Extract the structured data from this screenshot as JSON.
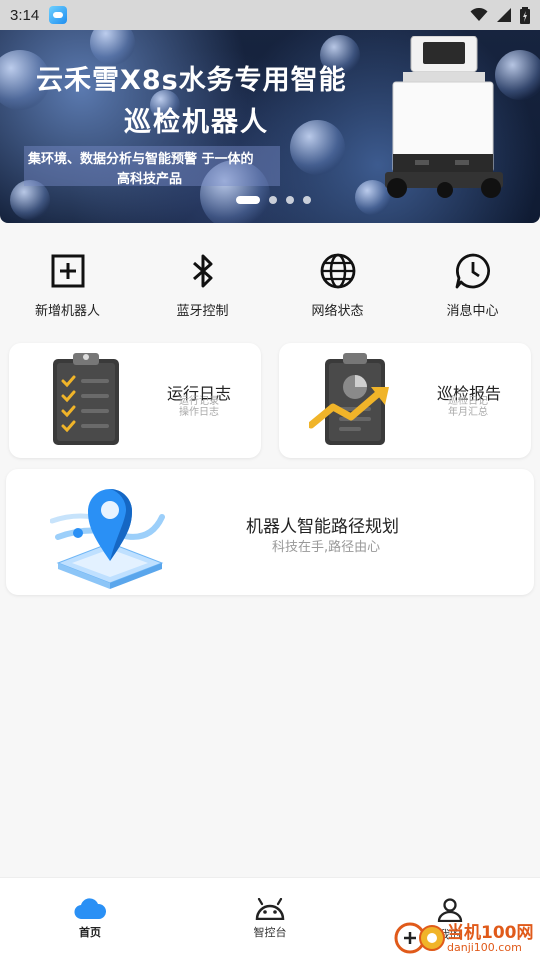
{
  "status_bar": {
    "time": "3:14"
  },
  "banner": {
    "title_line1": "云禾雪X8s水务专用智能",
    "title_line2": "巡检机器人",
    "subtitle_line1": "集环境、数据分析与智能预警 于一体的",
    "subtitle_line2": "高科技产品",
    "slide_count": 4,
    "active_slide": 1
  },
  "quick_actions": [
    {
      "label": "新增机器人",
      "icon": "add-square-icon"
    },
    {
      "label": "蓝牙控制",
      "icon": "bluetooth-icon"
    },
    {
      "label": "网络状态",
      "icon": "globe-icon"
    },
    {
      "label": "消息中心",
      "icon": "message-icon"
    }
  ],
  "cards": {
    "run_log": {
      "title": "运行日志",
      "sub1": "运行记录",
      "sub2": "操作日志",
      "icon": "clipboard-checklist-icon"
    },
    "patrol_report": {
      "title": "巡检报告",
      "sub1": "巡检日记",
      "sub2": "年月汇总",
      "icon": "report-chart-icon"
    },
    "path_planning": {
      "title": "机器人智能路径规划",
      "subtitle": "科技在手,路径由心",
      "icon": "map-pin-3d-icon"
    }
  },
  "tab_bar": {
    "home": "首页",
    "control": "智控台",
    "mine": "我的"
  },
  "watermark": {
    "line1": "当机100网",
    "line2": "danji100.com"
  },
  "colors": {
    "accent_blue": "#2a90f5",
    "background": "#f7f7f7",
    "watermark": "#e05a1a"
  }
}
